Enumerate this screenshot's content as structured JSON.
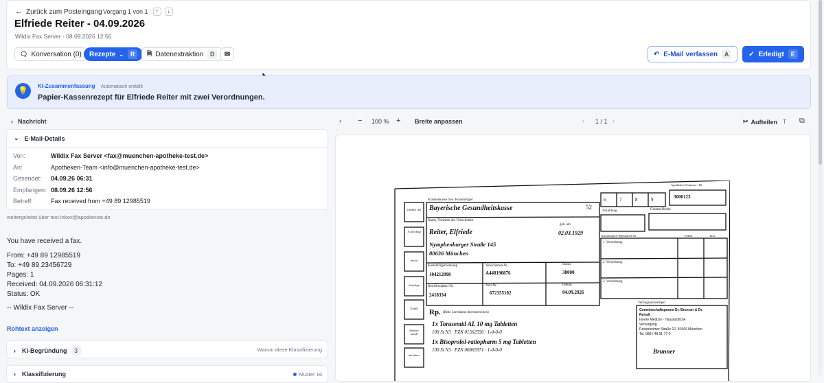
{
  "header": {
    "back_label": "Zurück zum Posteingang",
    "counter": "Vorgang 1 von 1",
    "title": "Elfriede Reiter - 04.09.2026",
    "subtitle": "Wildix Fax Server · 08.09.2026 12:56"
  },
  "tabs": {
    "conversation": "Konversation (0)",
    "recipes": "Rezepte",
    "recipes_key": "R",
    "extraction": "Datenextraktion",
    "extraction_key": "D"
  },
  "actions": {
    "email_label": "E-Mail verfassen",
    "email_key": "A",
    "done_label": "Erledigt",
    "done_key": "E"
  },
  "ai_summary": {
    "label": "KI-Zusammenfassung",
    "auto": "Automatisch erstellt",
    "text": "Papier-Kassenrezept für Elfriede Reiter mit zwei Verordnungen."
  },
  "message": {
    "back_label": "Nachricht",
    "details_title": "E-Mail-Details",
    "fields": [
      {
        "key": "Von:",
        "value": "Wildix Fax Server <fax@muenchen-apotheke-test.de>"
      },
      {
        "key": "An:",
        "value": "Apotheken-Team <info@muenchen-apotheke-test.de>"
      },
      {
        "key": "Gesendet:",
        "value": "04.09.26 06:31"
      },
      {
        "key": "Empfangen:",
        "value": "08.09.26 12:56"
      },
      {
        "key": "Betreff:",
        "value": "Fax received from +49 89 12985519"
      }
    ],
    "forwarded": "weitergeleitet über test-inbox@apodienste.de",
    "body": [
      "You have received a fax.",
      "",
      "From: +49 89 12985519",
      "To: +49 89 23456729",
      "Pages: 1",
      "Received: 04.09.2026 06:31:12",
      "Status: OK",
      "",
      "-- Wildix Fax Server --"
    ],
    "raw_link": "Rohtext anzeigen",
    "reason_title": "KI-Begründung",
    "reason_count": "3",
    "reason_hint": "Warum diese Klassifizierung",
    "classification_title": "Klassifizierung",
    "classification_value": "Muster 16"
  },
  "viewer": {
    "zoom": "100 %",
    "fit": "Breite anpassen",
    "page": "1 / 1",
    "split": "Aufteilen",
    "split_key": "T"
  },
  "prescription": {
    "insurer_label": "Krankenkasse bzw. Kostenträger",
    "insurer": "Bayerische Gesundheitskasse",
    "insurer_no": "52",
    "name_label": "Name, Vorname des Versicherten",
    "name": "Reiter, Elfriede",
    "dob_label": "geb. am",
    "dob": "02.03.1929",
    "street": "Nymphenburger Straße 145",
    "city": "80636 München",
    "kk_label": "Kostenträgerkennung",
    "kk": "104212098",
    "vn_label": "Versicherten-Nr.",
    "vn": "A448190876",
    "status_label": "Status",
    "status": "38000",
    "bsnr_label": "Betriebsstätten-Nr.",
    "bsnr": "2418334",
    "lanr_label": "Arzt-Nr.",
    "lanr": "672155102",
    "date_label": "Datum",
    "date": "04.09.2026",
    "rp": "Rp.",
    "rp_note": "(Bitte Leerräume durchstreichen)",
    "item1": "1x Torasemid AL 10 mg Tabletten",
    "item1b": "100 St N3 · PZN 01562556 · 1-0-0-0",
    "item2": "1x Bisoprolol-ratiopharm 5 mg Tabletten",
    "item2b": "100 St N3 · PZN 06865971 · 1-0-0-0",
    "side_boxes": [
      "Gebühr frei",
      "X pflichtig",
      "noctu",
      "Sonstige",
      "Unfall",
      "Arbeits-unfall",
      "aut idem"
    ],
    "top_digits": [
      "6",
      "7",
      "8",
      "9"
    ],
    "apo_label": "Apotheken-Nummer / IK",
    "apo_no": "3000123",
    "zuzahlung": "Zuzahlung",
    "gesamt": "Gesamt-Brutto",
    "arznei": "Arzneimittel-/Hilfsmittel-Nr.",
    "faktor": "Faktor",
    "taxe": "Taxe",
    "vo1": "1. Verordnung",
    "vo2": "2. Verordnung",
    "vo3": "3. Verordnung",
    "stamp_label": "Vertragsarztstempel",
    "stamp": [
      "Gemeinschaftspraxis Dr. Brunner & Dr.",
      "Reindl",
      "Innere Medizin - Hausärztliche",
      "Versorgung",
      "Rosenheimer Straße 12, 81669 München",
      "Tel. 089 / 48 91 77-0"
    ],
    "signature": "Brunner"
  }
}
